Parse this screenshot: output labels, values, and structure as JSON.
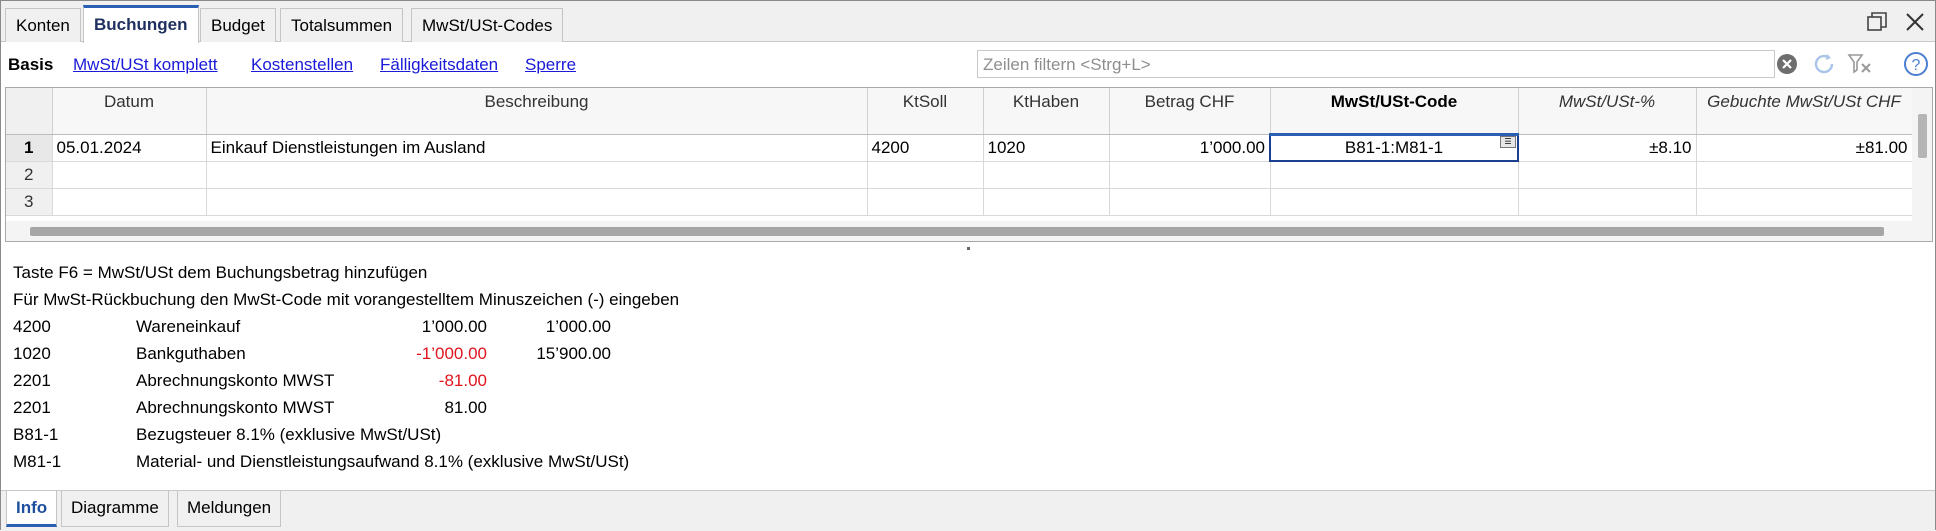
{
  "top_tabs": [
    "Konten",
    "Buchungen",
    "Budget",
    "Totalsummen",
    "MwSt/USt-Codes"
  ],
  "views": {
    "active": "Basis",
    "links": [
      "MwSt/USt komplett",
      "Kostenstellen",
      "Fälligkeitsdaten",
      "Sperre"
    ]
  },
  "filter": {
    "placeholder": "Zeilen filtern <Strg+L>"
  },
  "grid": {
    "columns": [
      "Datum",
      "Beschreibung",
      "KtSoll",
      "KtHaben",
      "Betrag CHF",
      "MwSt/USt-Code",
      "MwSt/USt-%",
      "Gebuchte MwSt/USt CHF"
    ],
    "rows": [
      {
        "n": "1",
        "datum": "05.01.2024",
        "beschreibung": "Einkauf Dienstleistungen im Ausland",
        "ktsoll": "4200",
        "kthaben": "1020",
        "betrag": "1’000.00",
        "code": "B81-1:M81-1",
        "pct": "±8.10",
        "gebucht": "±81.00"
      },
      {
        "n": "2",
        "datum": "",
        "beschreibung": "",
        "ktsoll": "",
        "kthaben": "",
        "betrag": "",
        "code": "",
        "pct": "",
        "gebucht": ""
      },
      {
        "n": "3",
        "datum": "",
        "beschreibung": "",
        "ktsoll": "",
        "kthaben": "",
        "betrag": "",
        "code": "",
        "pct": "",
        "gebucht": ""
      }
    ]
  },
  "info": {
    "hint1": "Taste F6 = MwSt/USt dem Buchungsbetrag hinzufügen",
    "hint2": "Für MwSt-Rückbuchung den MwSt-Code mit vorangestelltem Minuszeichen (-) eingeben",
    "lines": [
      {
        "code": "4200",
        "name": "Wareneinkauf",
        "amount": "1’000.00",
        "balance": "1’000.00",
        "negative": false
      },
      {
        "code": "1020",
        "name": "Bankguthaben",
        "amount": "-1’000.00",
        "balance": "15’900.00",
        "negative": true
      },
      {
        "code": "2201",
        "name": "Abrechnungskonto MWST",
        "amount": "-81.00",
        "balance": "",
        "negative": true
      },
      {
        "code": "2201",
        "name": "Abrechnungskonto MWST",
        "amount": "81.00",
        "balance": "",
        "negative": false
      },
      {
        "code": "B81-1",
        "name": "Bezugsteuer 8.1% (exklusive MwSt/USt)",
        "amount": "",
        "balance": "",
        "negative": false
      },
      {
        "code": "M81-1",
        "name": "Material- und Dienstleistungsaufwand 8.1% (exklusive MwSt/USt)",
        "amount": "",
        "balance": "",
        "negative": false
      }
    ]
  },
  "bottom_tabs": [
    "Info",
    "Diagramme",
    "Meldungen"
  ],
  "colors": {
    "accent": "#2b5fb4",
    "link": "#1a1ad8",
    "negative": "#e0141e"
  }
}
